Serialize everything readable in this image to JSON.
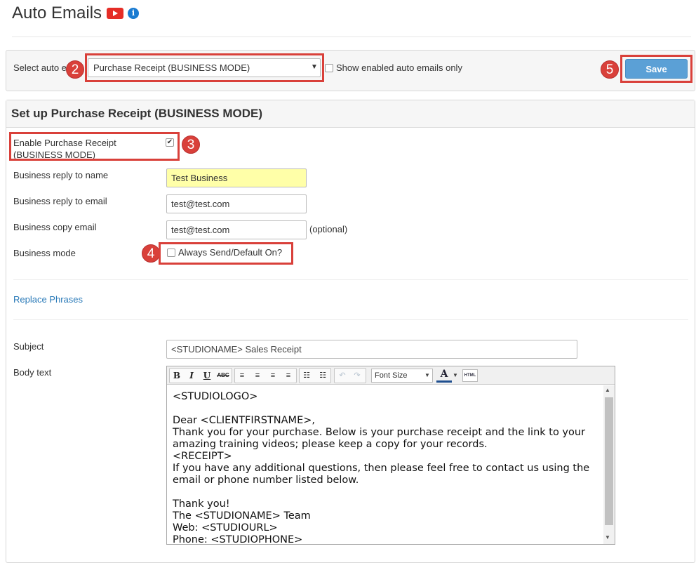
{
  "page": {
    "title": "Auto Emails"
  },
  "top_panel": {
    "select_label": "Select auto e",
    "select_value": "Purchase Receipt (BUSINESS MODE)",
    "show_enabled_label": "Show enabled auto emails only",
    "save_label": "Save"
  },
  "badges": {
    "b2": "2",
    "b3": "3",
    "b4": "4",
    "b5": "5"
  },
  "setup": {
    "title": "Set up Purchase Receipt (BUSINESS MODE)",
    "enable_label_1": "Enable Purchase Receipt",
    "enable_label_2": "(BUSINESS MODE)",
    "enable_checked": true,
    "reply_name_label": "Business reply to name",
    "reply_name_value": "Test Business",
    "reply_email_label": "Business reply to email",
    "reply_email_value": "test@test.com",
    "copy_email_label": "Business copy email",
    "copy_email_value": "test@test.com",
    "optional_text": "(optional)",
    "mode_label": "Business mode",
    "mode_checkbox_label": "Always Send/Default On?",
    "replace_phrases": "Replace Phrases",
    "subject_label": "Subject",
    "subject_value": "<STUDIONAME> Sales Receipt",
    "body_label": "Body text"
  },
  "editor": {
    "font_size_label": "Font Size",
    "html_label": "HTML",
    "toolbar": {
      "bold": "B",
      "italic": "I",
      "underline": "U",
      "strike": "ABC",
      "align_left": "≡",
      "align_center": "≡",
      "align_right": "≡",
      "justify": "≡",
      "bullets": "☷",
      "numbers": "☷",
      "undo": "↶",
      "redo": "↷",
      "color": "A"
    },
    "lines": [
      "<STUDIOLOGO>",
      "",
      "Dear <CLIENTFIRSTNAME>,",
      "Thank you for your purchase. Below is your purchase receipt and the link to your",
      "amazing training videos; please keep a copy for your records.",
      "<RECEIPT>",
      "If you have any additional questions, then please feel free to contact us using the",
      "email or phone number listed below.",
      "",
      "Thank you!",
      "The <STUDIONAME> Team",
      "Web: <STUDIOURL>",
      "Phone: <STUDIOPHONE>"
    ]
  },
  "icons": {
    "youtube": "youtube-icon",
    "info": "info-icon",
    "colors": {
      "accent_red": "#d9403a",
      "save_blue": "#5ba0d6",
      "link_blue": "#2a7ab8",
      "highlight_yellow": "#ffffa8"
    }
  }
}
